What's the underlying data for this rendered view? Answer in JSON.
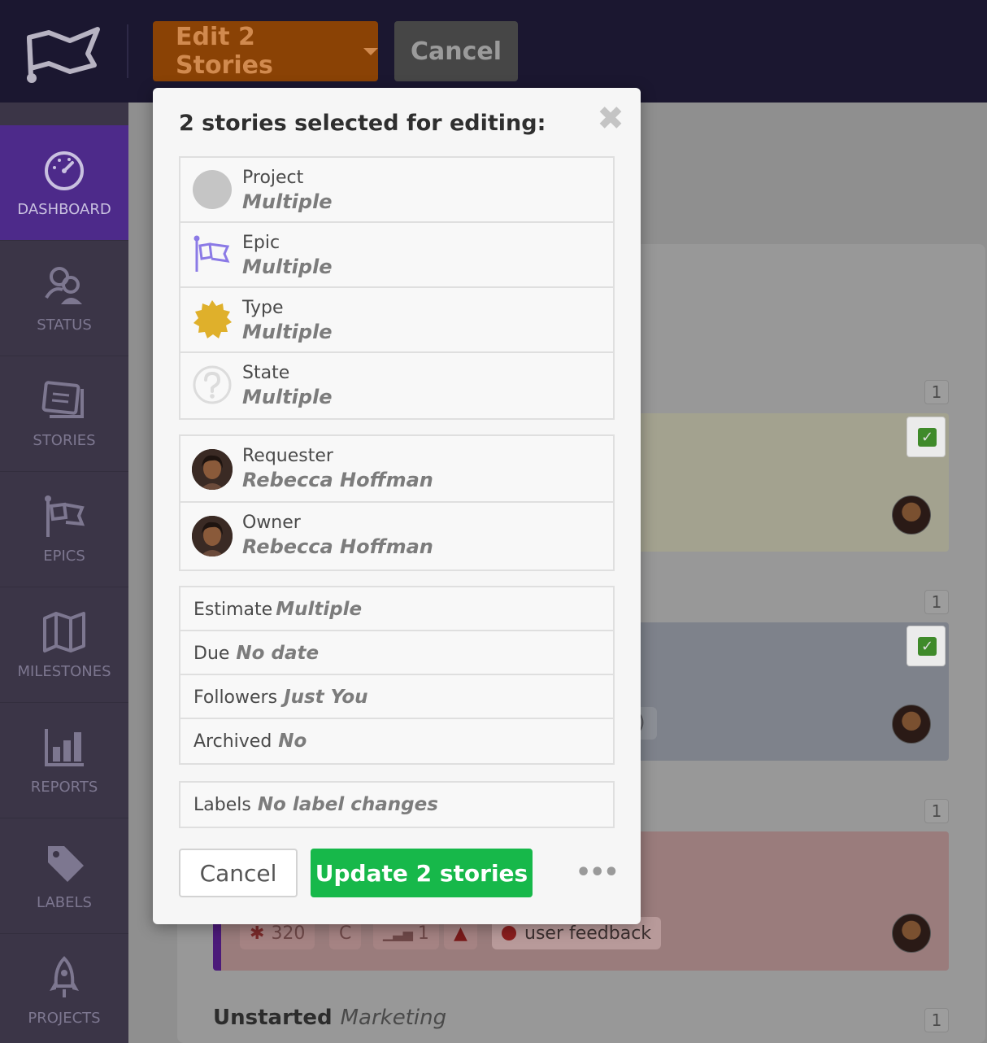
{
  "header": {
    "edit_label": "Edit 2 Stories",
    "cancel_label": "Cancel"
  },
  "sidebar": {
    "items": [
      {
        "label": "DASHBOARD",
        "icon": "dashboard-icon",
        "active": true
      },
      {
        "label": "STATUS",
        "icon": "status-icon"
      },
      {
        "label": "STORIES",
        "icon": "stories-icon"
      },
      {
        "label": "EPICS",
        "icon": "epics-icon"
      },
      {
        "label": "MILESTONES",
        "icon": "milestones-icon"
      },
      {
        "label": "REPORTS",
        "icon": "reports-icon"
      },
      {
        "label": "LABELS",
        "icon": "labels-icon"
      },
      {
        "label": "PROJECTS",
        "icon": "projects-icon"
      }
    ]
  },
  "background": {
    "counts": [
      "1",
      "1",
      "1",
      "1"
    ],
    "story_chips": {
      "estimate": "320",
      "type": "C",
      "points": "1",
      "label": "user feedback"
    },
    "section_title": "Unstarted",
    "section_project": "Marketing",
    "partial_chip": ")"
  },
  "modal": {
    "title": "2 stories selected for editing:",
    "fields_main": [
      {
        "label": "Project",
        "value": "Multiple",
        "icon": "project-circle-icon"
      },
      {
        "label": "Epic",
        "value": "Multiple",
        "icon": "epic-flag-icon"
      },
      {
        "label": "Type",
        "value": "Multiple",
        "icon": "type-badge-icon"
      },
      {
        "label": "State",
        "value": "Multiple",
        "icon": "question-icon"
      }
    ],
    "fields_people": [
      {
        "label": "Requester",
        "value": "Rebecca Hoffman"
      },
      {
        "label": "Owner",
        "value": "Rebecca Hoffman"
      }
    ],
    "fields_meta": [
      {
        "label": "Estimate",
        "value": "Multiple"
      },
      {
        "label": "Due",
        "value": "No date"
      },
      {
        "label": "Followers",
        "value": "Just You"
      },
      {
        "label": "Archived",
        "value": "No"
      }
    ],
    "labels": {
      "label": "Labels",
      "value": "No label changes"
    },
    "cancel_label": "Cancel",
    "update_label": "Update 2 stories",
    "more_label": "•••"
  },
  "colors": {
    "accent_purple": "#4d2a8a",
    "update_green": "#17b84a",
    "edit_orange": "#8a4205",
    "epic_purple": "#8b7ae6",
    "type_yellow": "#dfb02b"
  }
}
